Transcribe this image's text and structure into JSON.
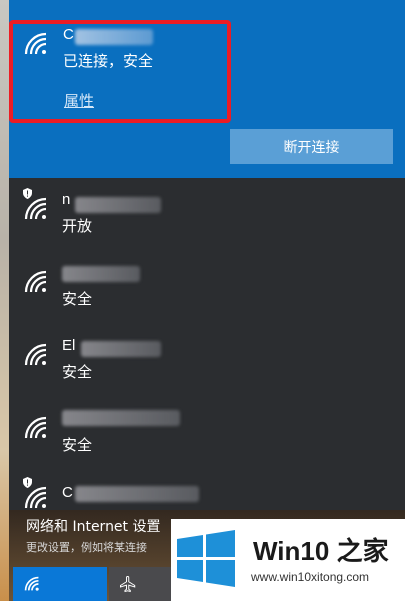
{
  "connected": {
    "name": "C",
    "status": "已连接，安全",
    "properties_link": "属性",
    "disconnect_button": "断开连接"
  },
  "networks": [
    {
      "name": "n",
      "status": "开放",
      "secured": false,
      "shield": true
    },
    {
      "name": "",
      "status": "安全",
      "secured": true,
      "shield": false
    },
    {
      "name": "El",
      "status": "安全",
      "secured": true,
      "shield": false
    },
    {
      "name": "",
      "status": "安全",
      "secured": true,
      "shield": false
    },
    {
      "name": "C",
      "status": "",
      "secured": true,
      "shield": true
    }
  ],
  "settings": {
    "title": "网络和 Internet 设置",
    "subtitle": "更改设置，例如将某连接"
  },
  "quick_actions": [
    {
      "icon": "wifi-icon"
    },
    {
      "icon": "airplane-icon"
    }
  ],
  "watermark": {
    "brand": "Win10",
    "brand_suffix": "之家",
    "url": "www.win10xitong.com"
  },
  "colors": {
    "accent": "#0a6fbf",
    "flyout_bg": "#2b2d30",
    "highlight_border": "#ec1c24",
    "windows_logo": "#1e90d8"
  }
}
